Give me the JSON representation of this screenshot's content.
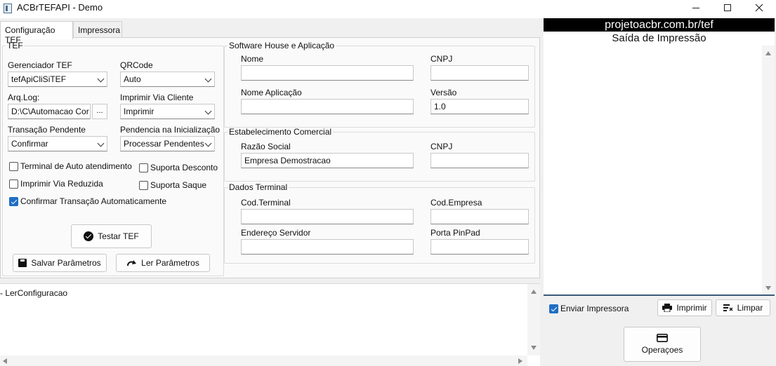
{
  "window": {
    "title": "ACBrTEFAPI - Demo"
  },
  "tabs": [
    {
      "label": "Configuração TEF",
      "active": true
    },
    {
      "label": "Impressora",
      "active": false
    }
  ],
  "tef_group": {
    "legend": "TEF",
    "gerenciador_label": "Gerenciador TEF",
    "gerenciador_value": "tefApiCliSiTEF",
    "qrcode_label": "QRCode",
    "qrcode_value": "Auto",
    "arqlog_label": "Arq.Log:",
    "arqlog_value": "D:\\C\\Automacao Cor",
    "browse_label": "...",
    "imprimir_via_label": "Imprimir Via Cliente",
    "imprimir_via_value": "Imprimir",
    "transacao_label": "Transação Pendente",
    "transacao_value": "Confirmar",
    "pendencia_label": "Pendencia na Inicialização",
    "pendencia_value": "Processar Pendentes",
    "chk_auto_atendimento": "Terminal de Auto atendimento",
    "chk_desconto": "Suporta Desconto",
    "chk_via_reduzida": "Imprimir Via Reduzida",
    "chk_saque": "Suporta Saque",
    "chk_confirmar": "Confirmar Transação Automaticamente",
    "testar_label": "Testar TEF",
    "salvar_label": "Salvar Parâmetros",
    "ler_label": "Ler Parâmetros"
  },
  "software_house": {
    "legend": "Software House e Aplicação",
    "nome_label": "Nome",
    "nome_value": "",
    "cnpj_label": "CNPJ",
    "cnpj_value": "",
    "nome_app_label": "Nome Aplicação",
    "nome_app_value": "",
    "versao_label": "Versão",
    "versao_value": "1.0"
  },
  "estabelecimento": {
    "legend": "Estabelecimento Comercial",
    "razao_label": "Razão Social",
    "razao_value": "Empresa Demostracao",
    "cnpj_label": "CNPJ",
    "cnpj_value": ""
  },
  "terminal": {
    "legend": "Dados Terminal",
    "cod_terminal_label": "Cod.Terminal",
    "cod_empresa_label": "Cod.Empresa",
    "endereco_label": "Endereço Servidor",
    "porta_label": "Porta PinPad"
  },
  "log": {
    "line": "- LerConfiguracao"
  },
  "right_panel": {
    "header": "projetoacbr.com.br/tef",
    "subheader": "Saída de Impressão",
    "enviar_label": "Enviar Impressora",
    "imprimir_label": "Imprimir",
    "limpar_label": "Limpar",
    "operacoes_label": "Operaçoes"
  },
  "icons": [
    "check-circle-icon",
    "save-icon",
    "redo-icon",
    "printer-icon",
    "clear-icon",
    "card-icon"
  ]
}
